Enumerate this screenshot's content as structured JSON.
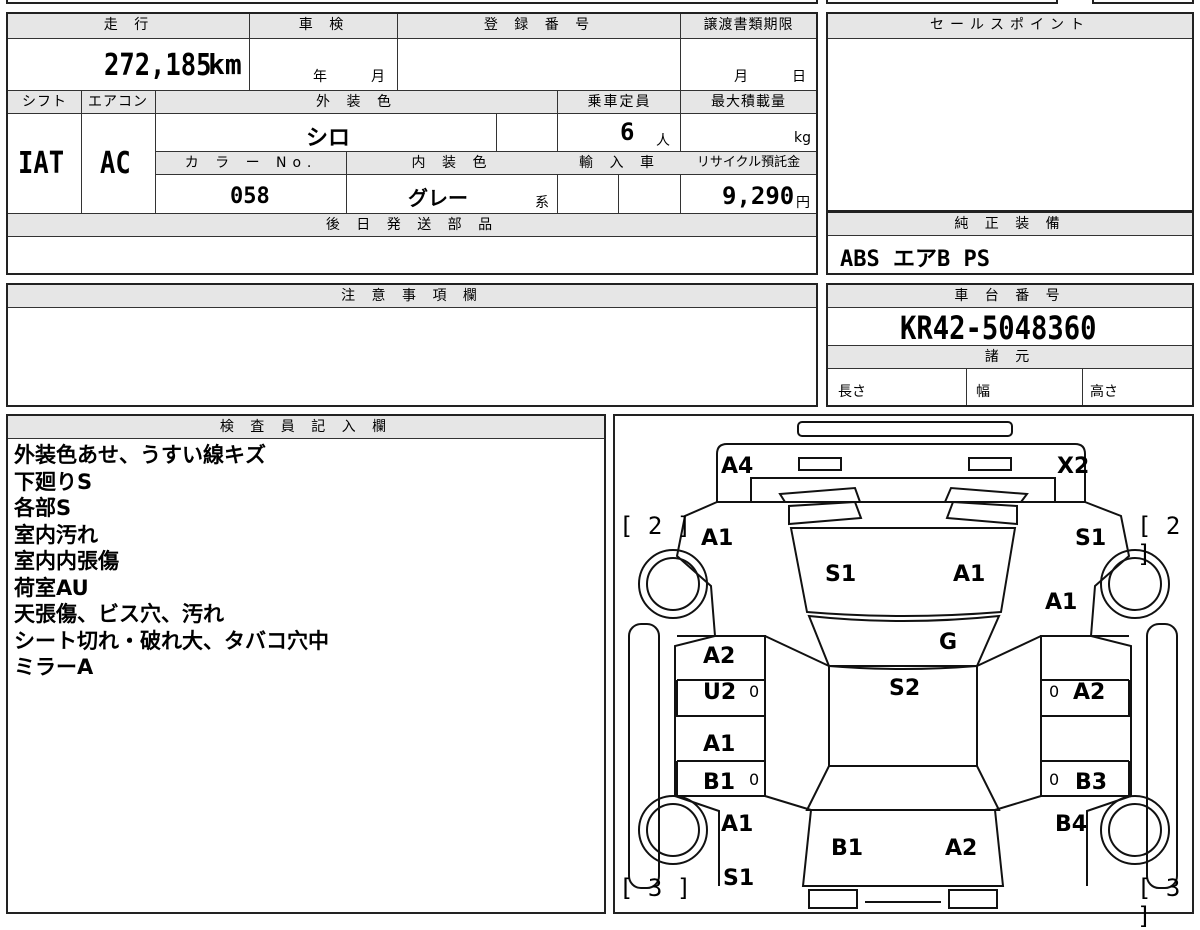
{
  "top_cut": {
    "a": "",
    "b": ""
  },
  "vehicle": {
    "mileage_label": "走 行",
    "mileage": "272,185",
    "mileage_unit": "km",
    "inspection_label": "車 検",
    "inspection_year": "年",
    "inspection_month": "月",
    "registration_label": "登 録 番 号",
    "transfer_label": "譲渡書類期限",
    "transfer_month": "月",
    "transfer_day": "日",
    "shift_label": "シフト",
    "shift": "IAT",
    "ac_label": "エアコン",
    "ac": "AC",
    "exterior_label": "外 装 色",
    "exterior": "シロ",
    "capacity_label": "乗車定員",
    "capacity": "6",
    "capacity_unit": "人",
    "maxload_label": "最大積載量",
    "maxload_unit": "kg",
    "colorno_label": "カ ラ ー No.",
    "colorno": "058",
    "interior_label": "内 装 色",
    "interior": "グレー",
    "interior_suffix": "系",
    "import_label": "輸 入 車",
    "recycle_label": "リサイクル預託金",
    "recycle": "9,290",
    "recycle_unit": "円",
    "later_parts_label": "後 日 発 送 部 品"
  },
  "sale": {
    "label": "セールスポイント"
  },
  "equipment": {
    "label": "純 正 装 備",
    "value": "ABS エアB PS"
  },
  "caution": {
    "label": "注 意 事 項 欄"
  },
  "chassis": {
    "label": "車 台 番 号",
    "value": "KR42-5048360",
    "spec_label": "諸 元",
    "length": "長さ",
    "width": "幅",
    "height": "高さ"
  },
  "inspector": {
    "label": "検 査 員 記 入 欄",
    "lines": [
      "外装色あせ、うすい線キズ",
      "下廻りS",
      "各部S",
      "室内汚れ",
      "室内内張傷",
      "荷室AU",
      "天張傷、ビス穴、汚れ",
      "シート切れ・破れ大、タバコ穴中",
      "ミラーA"
    ]
  },
  "diagram": {
    "marks": {
      "a4": "A4",
      "x2": "X2",
      "tl_a1": "A1",
      "tr_s1": "S1",
      "hood_s1": "S1",
      "hood_a1": "A1",
      "right_a1": "A1",
      "g": "G",
      "roof_s2": "S2",
      "l_a2": "A2",
      "l_u2": "U2",
      "r_a2": "A2",
      "l_a1": "A1",
      "l_b1": "B1",
      "r_b3": "B3",
      "bl_a1": "A1",
      "br_b4": "B4",
      "trunk_b1": "B1",
      "trunk_a2": "A2",
      "bottom_s1": "S1"
    },
    "tire_left_front": "[ 2 ]",
    "tire_right_front": "[ 2 ]",
    "tire_left_rear": "[ 3 ]",
    "tire_right_rear": "[ 3 ]",
    "zero": "0"
  }
}
